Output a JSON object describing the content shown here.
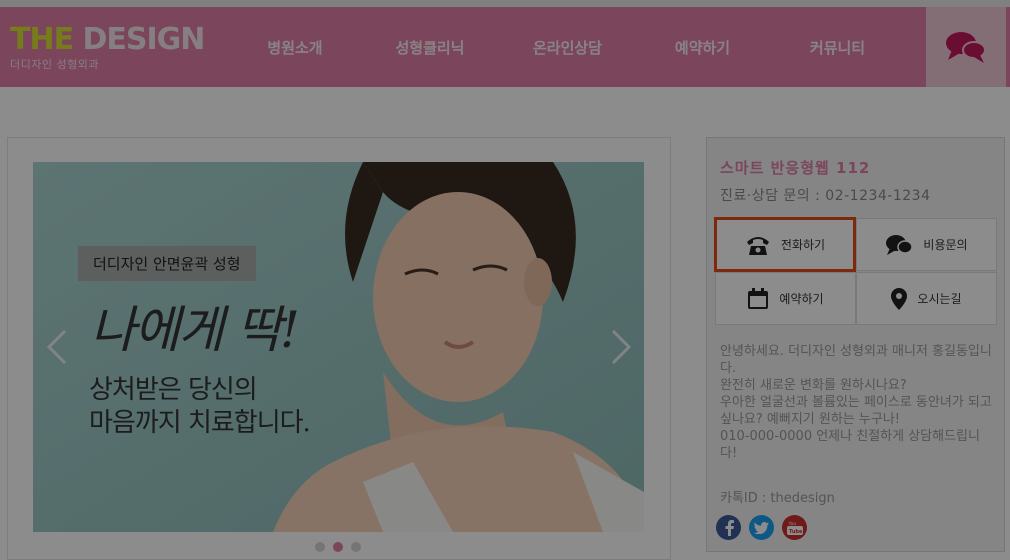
{
  "header": {
    "logo_the": "THE",
    "logo_design": " DESIGN",
    "logo_sub": "더디자인 성형외과",
    "nav": [
      "병원소개",
      "성형클리닉",
      "온라인상담",
      "예약하기",
      "커뮤니티"
    ]
  },
  "slider": {
    "badge": "더디자인 안면윤곽 성형",
    "title": "나에게 딱!",
    "subtitle_line1": "상처받은 당신의",
    "subtitle_line2": "마음까지 치료합니다.",
    "dots": 3,
    "active_dot": 2
  },
  "panel": {
    "title": "스마트 반응형웹 112",
    "phone": "진료·상담 문의 : 02-1234-1234",
    "buttons": {
      "call": "전화하기",
      "cost": "비용문의",
      "reserve": "예약하기",
      "directions": "오시는길"
    },
    "message": "안녕하세요. 더디자인 성형외과 매니저 홍길동입니다.\n완전히 새로운 변화를 원하시나요?\n우아한 얼굴선과 볼륨있는 페이스로 동안녀가 되고싶나요? 예뻐지기 원하는 누구나!\n010-000-0000 언제나 친절하게 상담해드립니다!",
    "kakao": "카톡ID : thedesign"
  },
  "colors": {
    "brand_pink": "#e07fa6",
    "highlight": "#e64a19",
    "facebook": "#3b5998",
    "twitter": "#1da1f2",
    "youtube": "#cc2e2e"
  }
}
